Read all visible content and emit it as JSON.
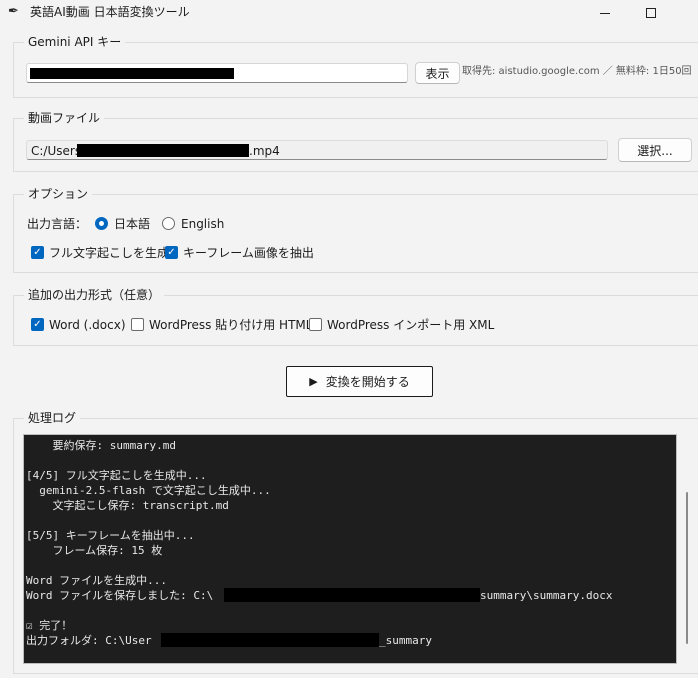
{
  "window": {
    "title": "英語AI動画 日本語変換ツール",
    "app_icon": "feather-icon",
    "minimize_icon": "minimize-icon",
    "maximize_icon": "maximize-icon"
  },
  "api_key": {
    "legend": "Gemini API キー",
    "value_masked": true,
    "show_button": "表示",
    "note": "取得先: aistudio.google.com ／ 無料枠: 1日50回"
  },
  "video_file": {
    "legend": "動画ファイル",
    "path_prefix": "C:/Users/",
    "path_suffix": ".mp4",
    "select_button": "選択..."
  },
  "options": {
    "legend": "オプション",
    "output_language_label": "出力言語：",
    "languages": [
      {
        "label": "日本語",
        "selected": true
      },
      {
        "label": "English",
        "selected": false
      }
    ],
    "checks": [
      {
        "label": "フル文字起こしを生成",
        "checked": true
      },
      {
        "label": "キーフレーム画像を抽出",
        "checked": true
      }
    ]
  },
  "extra_formats": {
    "legend": "追加の出力形式（任意）",
    "checks": [
      {
        "label": "Word (.docx)",
        "checked": true
      },
      {
        "label": "WordPress 貼り付け用 HTML",
        "checked": false
      },
      {
        "label": "WordPress インポート用 XML",
        "checked": false
      }
    ]
  },
  "start_button": {
    "label": "変換を開始する",
    "icon": "play-icon"
  },
  "log": {
    "legend": "処理ログ",
    "lines": [
      "    要約保存: summary.md",
      "",
      "[4/5] フル文字起こしを生成中...",
      "  gemini-2.5-flash で文字起こし生成中...",
      "    文字起こし保存: transcript.md",
      "",
      "[5/5] キーフレームを抽出中...",
      "    フレーム保存: 15 枚",
      "",
      "Word ファイルを生成中...",
      "Word ファイルを保存しました: C:\\",
      "",
      "☑ 完了！",
      "出力フォルダ: C:\\User"
    ],
    "line_10_tail": "summary\\summary.docx",
    "line_13_tail": "_summary"
  },
  "colors": {
    "accent": "#0067c0",
    "log_background": "#1e1e1e",
    "log_text": "#e8e8e8",
    "window_background": "#f3f3f3"
  }
}
